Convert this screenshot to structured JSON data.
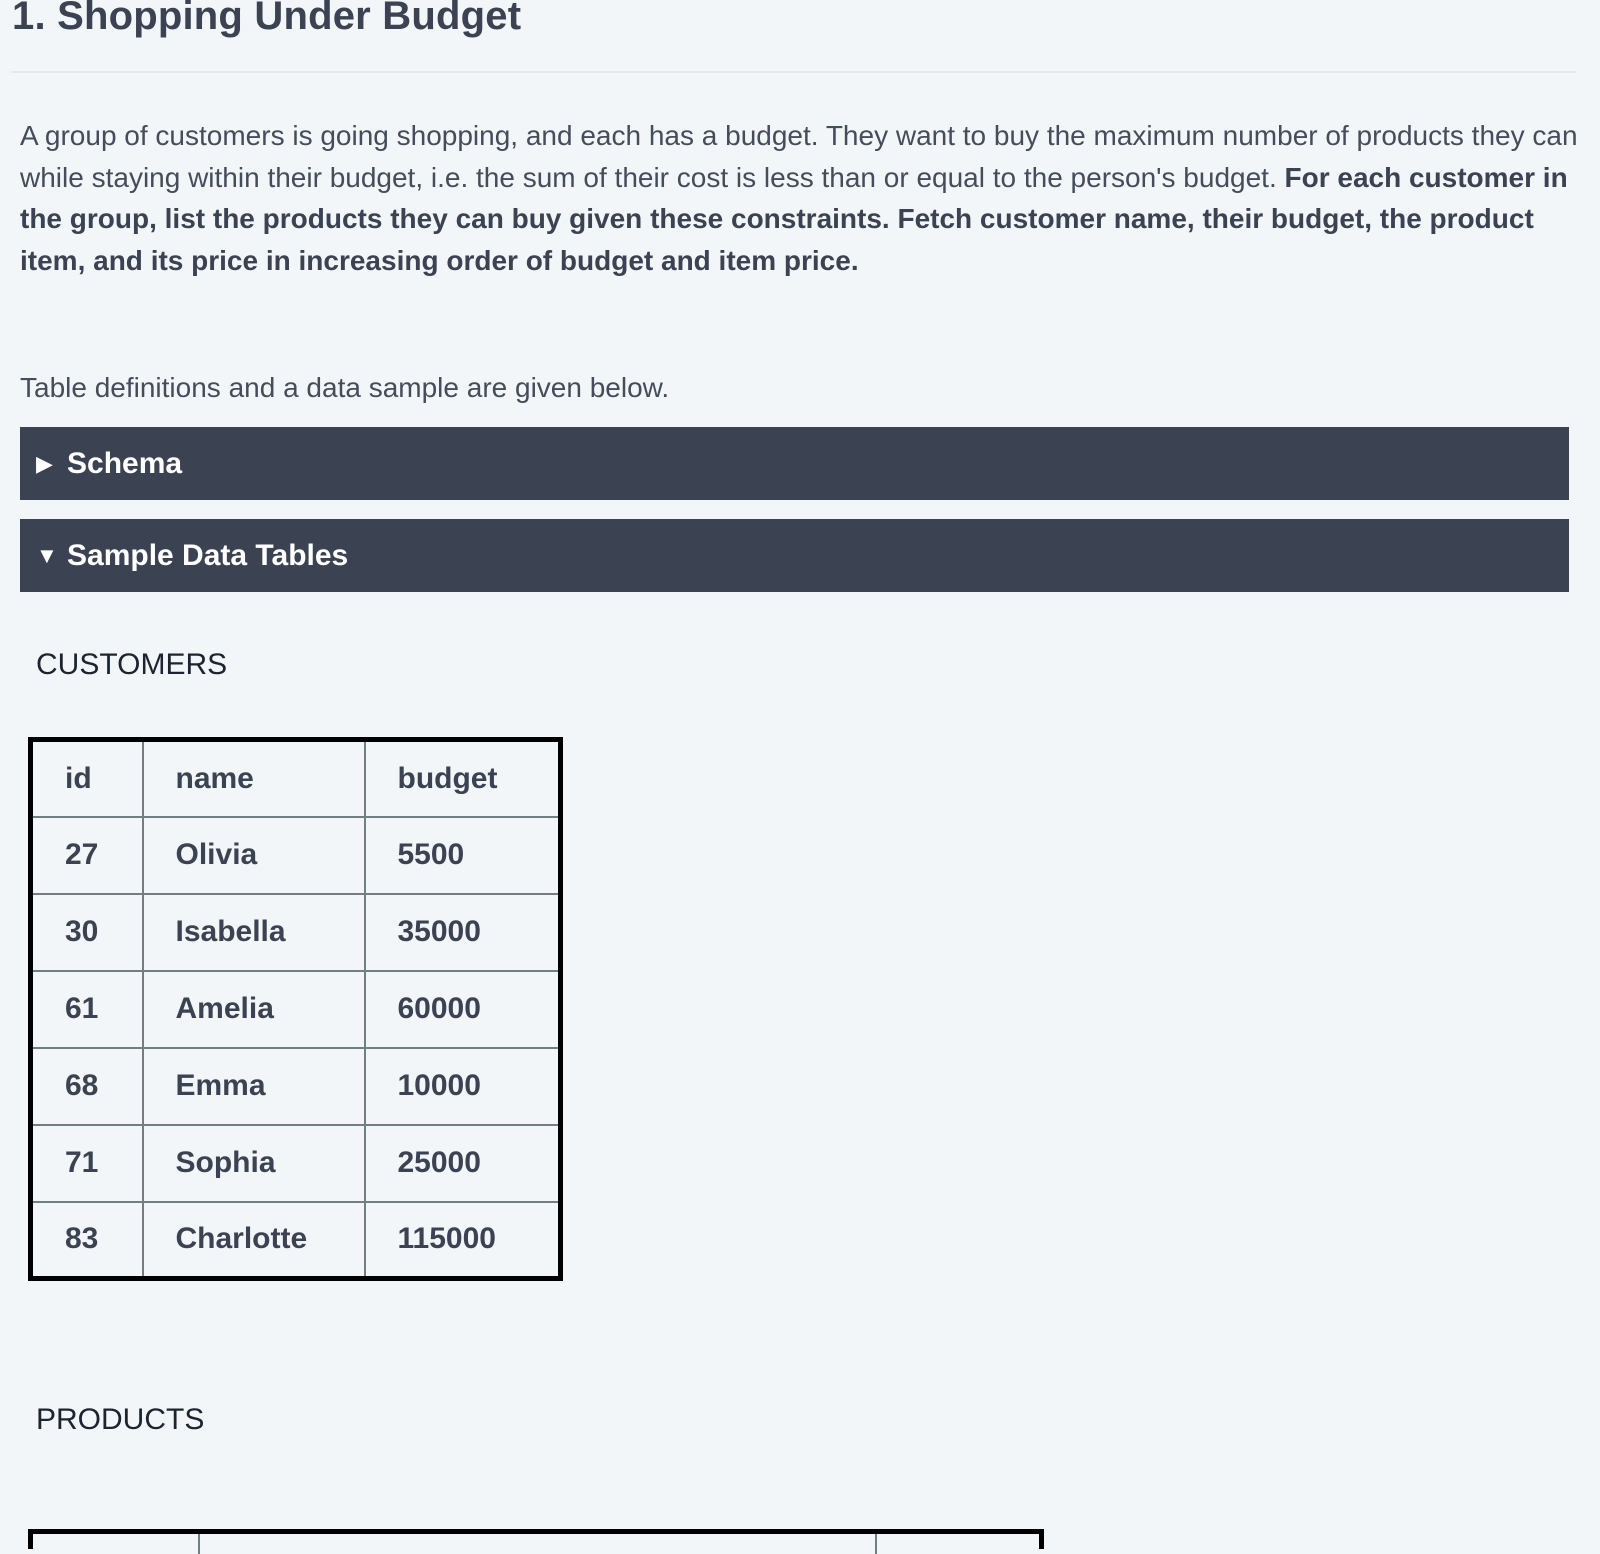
{
  "title": "1. Shopping Under Budget",
  "description": {
    "plain": "A group of customers is going shopping, and each has a budget. They want to buy the maximum number of products they can while staying within their budget, i.e. the sum of their cost is less than or equal to the person's budget. ",
    "bold": "For each customer in the group, list the products they can buy given these constraints. Fetch customer name, their budget, the product item, and its price in increasing order of budget and item price."
  },
  "intro": "Table definitions and a data sample are given below.",
  "accordions": {
    "schema": {
      "label": "Schema",
      "icon": "triangle-right-icon",
      "glyph": "▶",
      "expanded": false
    },
    "sample": {
      "label": "Sample Data Tables",
      "icon": "triangle-down-icon",
      "glyph": "▼",
      "expanded": true
    }
  },
  "customers": {
    "title": "CUSTOMERS",
    "headers": [
      "id",
      "name",
      "budget"
    ],
    "rows": [
      [
        "27",
        "Olivia",
        "5500"
      ],
      [
        "30",
        "Isabella",
        "35000"
      ],
      [
        "61",
        "Amelia",
        "60000"
      ],
      [
        "68",
        "Emma",
        "10000"
      ],
      [
        "71",
        "Sophia",
        "25000"
      ],
      [
        "83",
        "Charlotte",
        "115000"
      ]
    ]
  },
  "products": {
    "title": "PRODUCTS"
  }
}
